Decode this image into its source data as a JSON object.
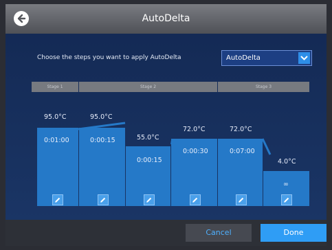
{
  "window": {
    "title": "AutoDelta"
  },
  "prompt": "Choose the steps you want to apply AutoDelta",
  "select": {
    "value": "AutoDelta"
  },
  "stages": [
    "Stage 1",
    "Stage 2",
    "Stage 3"
  ],
  "steps": [
    {
      "temp": "95.0°C",
      "time": "0:01:00"
    },
    {
      "temp": "95.0°C",
      "time": "0:00:15"
    },
    {
      "temp": "55.0°C",
      "time": "0:00:15"
    },
    {
      "temp": "72.0°C",
      "time": "0:00:30"
    },
    {
      "temp": "72.0°C",
      "time": "0:07:00"
    },
    {
      "temp": "4.0°C",
      "time": "∞"
    }
  ],
  "footer": {
    "cancel_label": "Cancel",
    "done_label": "Done"
  },
  "icons": {
    "back": "arrow-left-icon",
    "dropdown": "chevron-down-icon",
    "edit": "pencil-icon"
  },
  "colors": {
    "accent": "#2f9df5",
    "block": "#2579c8",
    "background": "#1b2d56"
  }
}
